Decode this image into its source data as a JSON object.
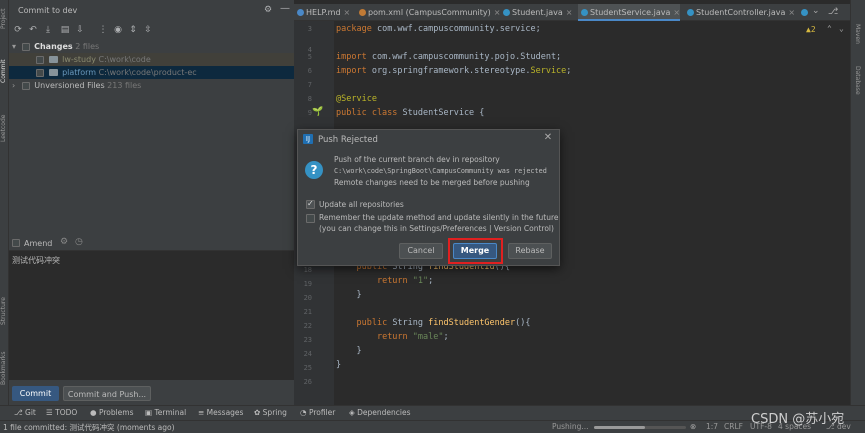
{
  "commit_panel": {
    "title": "Commit to dev",
    "changes_label": "Changes",
    "changes_count": "2 files",
    "changes": [
      {
        "name": "lw-study",
        "path": "C:\\work\\code"
      },
      {
        "name": "platform",
        "path": "C:\\work\\code\\product-ec"
      }
    ],
    "unversioned_label": "Unversioned Files",
    "unversioned_count": "213 files",
    "amend_label": "Amend",
    "commit_message": "测试代码冲突",
    "commit_button": "Commit",
    "commit_push_button": "Commit and Push..."
  },
  "left_stripe": {
    "project": "Project",
    "commit": "Commit",
    "leetcode": "Leetcode",
    "structure": "Structure",
    "bookmarks": "Bookmarks"
  },
  "right_stripe": {
    "maven": "Maven",
    "database": "Database"
  },
  "tabs": [
    {
      "label": "HELP.md",
      "color": "#4a88c7"
    },
    {
      "label": "pom.xml (CampusCommunity)",
      "color": "#c07a35"
    },
    {
      "label": "Student.java",
      "color": "#3592c4"
    },
    {
      "label": "StudentService.java",
      "color": "#3592c4"
    },
    {
      "label": "StudentController.java",
      "color": "#3592c4"
    }
  ],
  "branch_dropdown": "dev",
  "editor": {
    "warnings": "▲2",
    "lines_top": [
      {
        "n": "3",
        "text": "package com.wwf.campuscommunity.service;"
      },
      {
        "n": "4",
        "text": ""
      },
      {
        "n": "5",
        "text": "import com.wwf.campuscommunity.pojo.Student;"
      },
      {
        "n": "6",
        "text": "import org.springframework.stereotype.Service;"
      },
      {
        "n": "7",
        "text": ""
      },
      {
        "n": "8",
        "text": "@Service"
      },
      {
        "n": "9",
        "text": "public class StudentService {"
      }
    ],
    "lines_bottom": [
      {
        "n": "18",
        "text": "    public String findStudentId(){"
      },
      {
        "n": "19",
        "text": "        return \"1\";"
      },
      {
        "n": "20",
        "text": "    }"
      },
      {
        "n": "21",
        "text": ""
      },
      {
        "n": "22",
        "text": "    public String findStudentGender(){"
      },
      {
        "n": "23",
        "text": "        return \"male\";"
      },
      {
        "n": "24",
        "text": "    }"
      },
      {
        "n": "25",
        "text": "}"
      },
      {
        "n": "26",
        "text": ""
      }
    ]
  },
  "dialog": {
    "title": "Push Rejected",
    "line1": "Push of the current branch dev in repository",
    "line2": "C:\\work\\code\\SpringBoot\\CampusCommunity was rejected",
    "line3": "Remote changes need to be merged before pushing",
    "update_all": "Update all repositories",
    "remember": "Remember the update method and update silently in the future",
    "remember_hint": "(you can change this in Settings/Preferences | Version Control)",
    "cancel": "Cancel",
    "merge": "Merge",
    "rebase": "Rebase"
  },
  "tool_windows": [
    "Git",
    "TODO",
    "Problems",
    "Terminal",
    "Messages",
    "Spring",
    "Profiler",
    "Dependencies"
  ],
  "status": {
    "message": "1 file committed: 测试代码冲突 (moments ago)",
    "progress": "Pushing...",
    "position": "1:7",
    "line_sep": "CRLF",
    "encoding": "UTF-8",
    "indent": "4 spaces",
    "branch": "dev"
  },
  "watermark": "CSDN @苏小宛"
}
